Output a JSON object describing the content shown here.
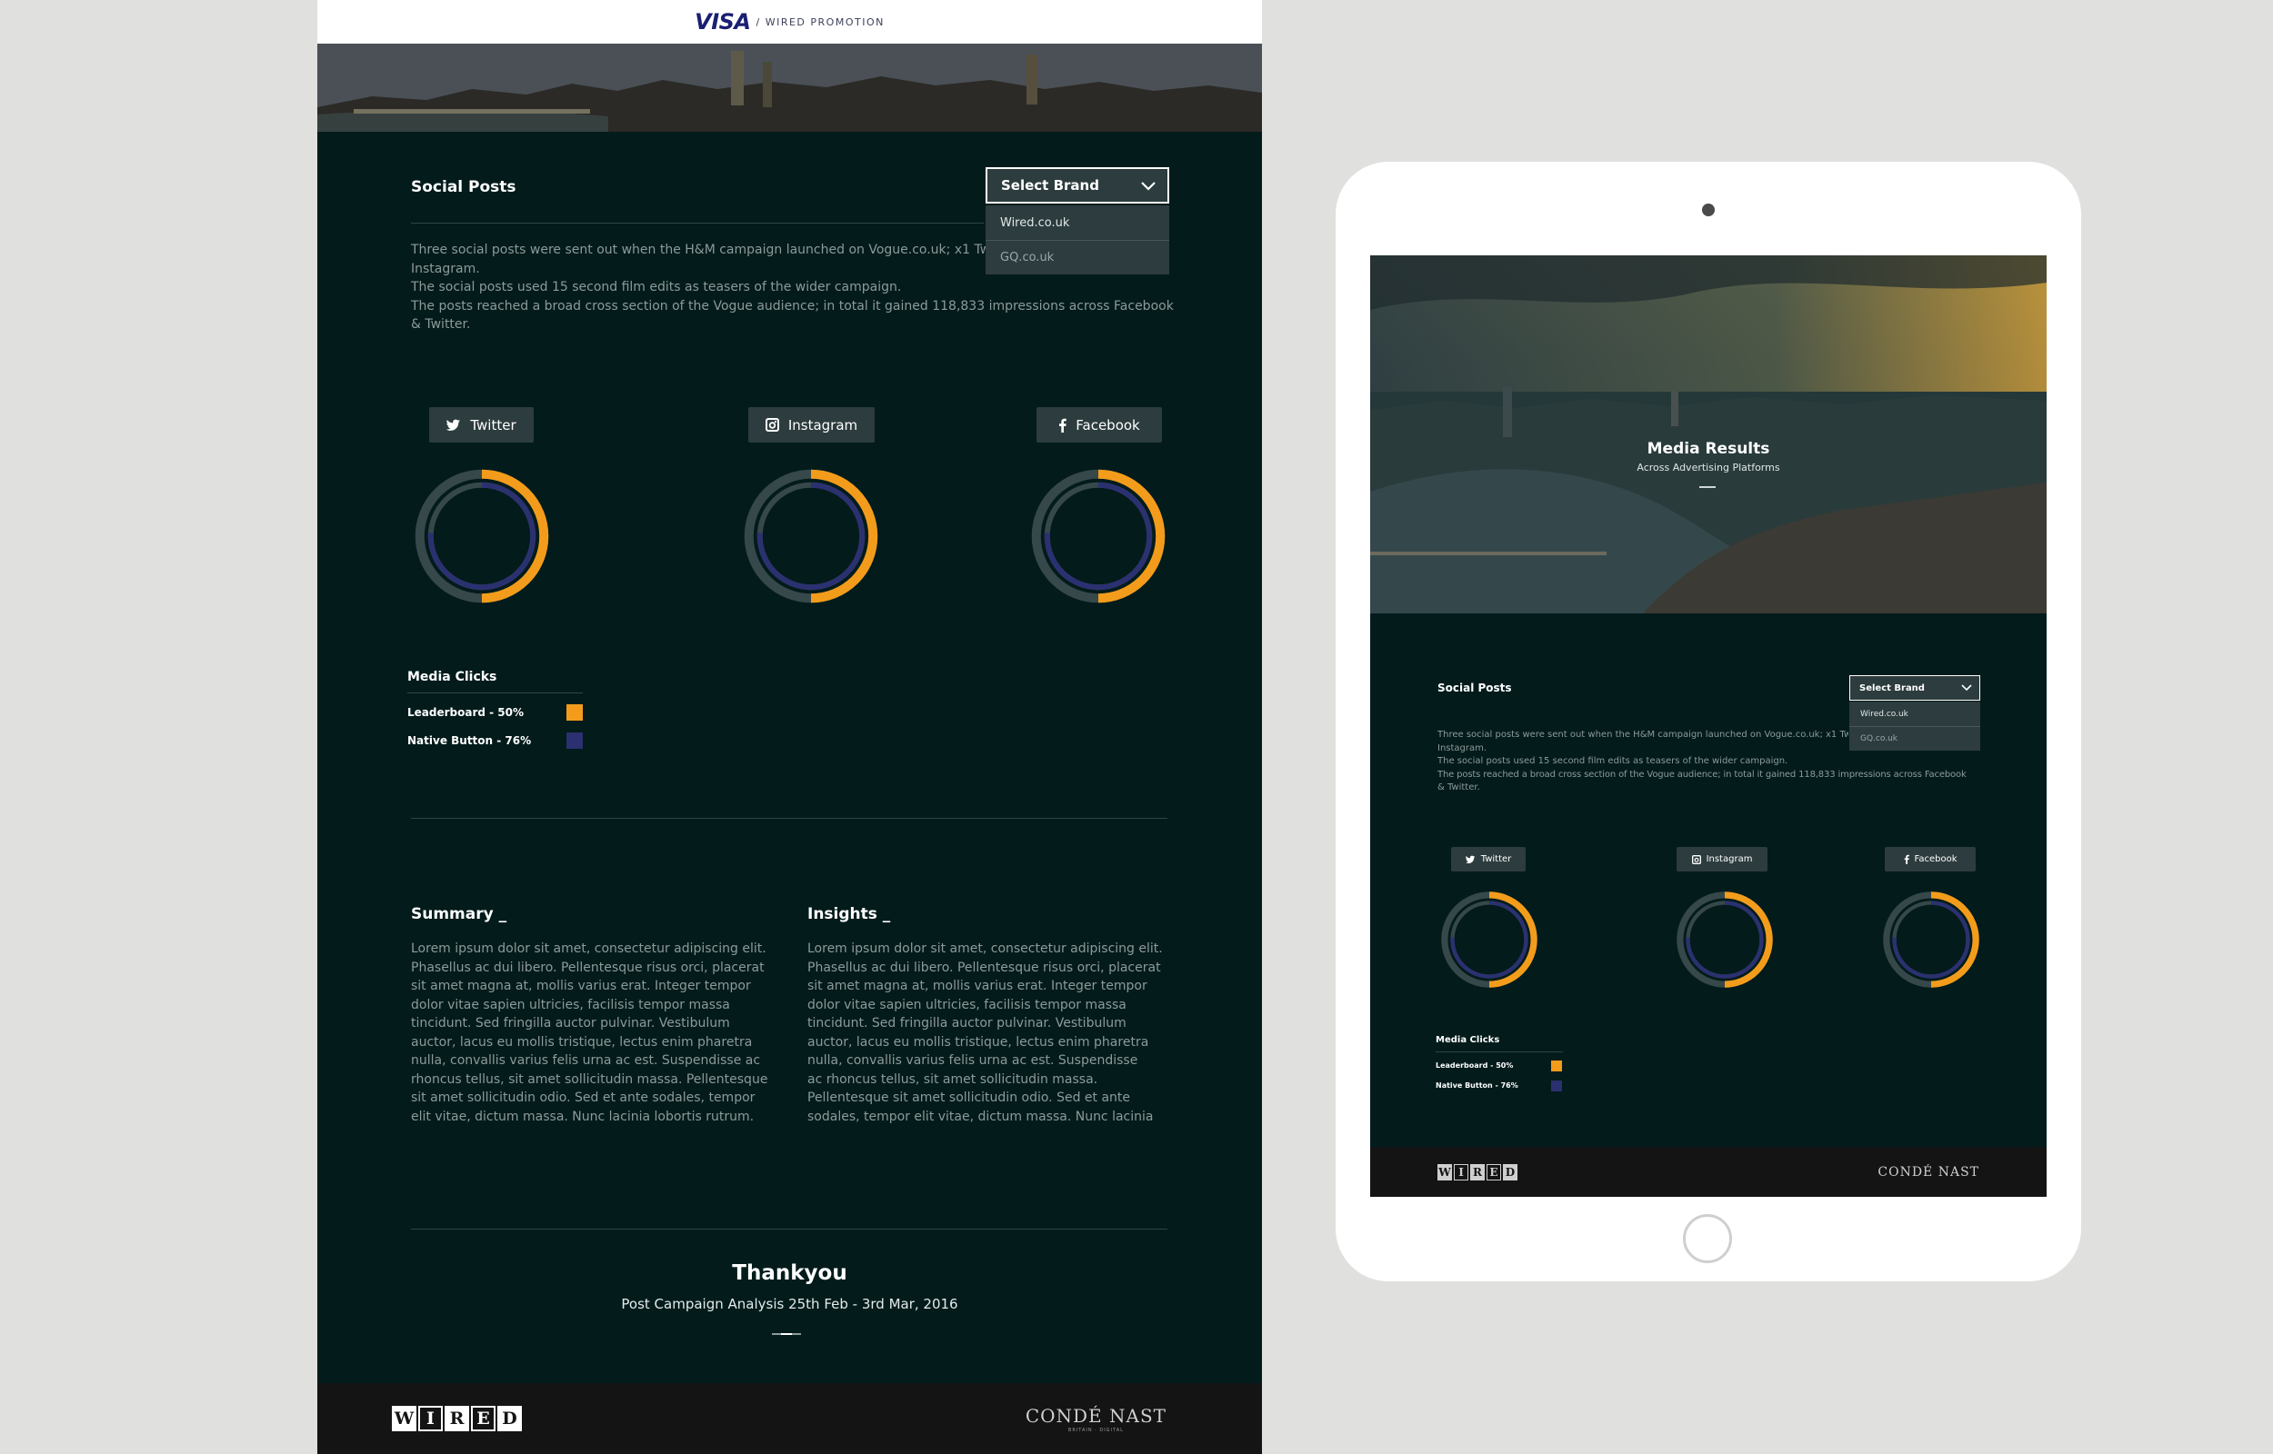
{
  "desktop": {
    "header": {
      "brand": "VISA",
      "tagline": "/ WIRED PROMOTION"
    },
    "social": {
      "title": "Social Posts",
      "select_label": "Select Brand",
      "options": [
        "Wired.co.uk",
        "GQ.co.uk"
      ],
      "paragraphs": [
        "Three social posts were sent out when the H&M campaign launched on Vogue.co.uk; x1 Twe",
        "Instagram.",
        "The social posts used 15 second film edits as teasers of the wider campaign.",
        "The posts reached a broad cross section of the Vogue audience; in total it gained 118,833 impressions across Facebook",
        "& Twitter."
      ],
      "buttons": [
        "Twitter",
        "Instagram",
        "Facebook"
      ]
    },
    "media_clicks": {
      "title": "Media Clicks",
      "items": [
        {
          "label": "Leaderboard - 50%",
          "value": 50,
          "color": "#f39c1b"
        },
        {
          "label": "Native Button - 76%",
          "value": 76,
          "color": "#2b3170"
        }
      ]
    },
    "summary": {
      "title": "Summary _",
      "lines": [
        "Lorem ipsum dolor sit amet, consectetur adipiscing elit.",
        "Phasellus ac dui libero. Pellentesque risus orci, placerat",
        "sit amet magna at, mollis varius erat. Integer tempor",
        "dolor vitae sapien ultricies, facilisis tempor massa",
        "tincidunt. Sed fringilla auctor pulvinar. Vestibulum",
        "auctor, lacus eu mollis tristique, lectus enim pharetra",
        "nulla, convallis varius felis urna ac est. Suspendisse ac",
        "rhoncus tellus, sit amet sollicitudin massa. Pellentesque",
        "sit amet sollicitudin odio. Sed et ante sodales, tempor",
        "elit vitae, dictum massa. Nunc lacinia lobortis rutrum."
      ]
    },
    "insights": {
      "title": "Insights _",
      "lines": [
        "Lorem ipsum dolor sit amet, consectetur adipiscing elit.",
        "Phasellus ac dui libero. Pellentesque risus orci, placerat",
        "sit amet magna at, mollis varius erat. Integer tempor",
        "dolor vitae sapien ultricies, facilisis tempor massa",
        "tincidunt. Sed fringilla auctor pulvinar. Vestibulum",
        "auctor, lacus eu mollis tristique, lectus enim pharetra",
        "nulla, convallis varius felis urna ac est. Suspendisse",
        "ac rhoncus tellus, sit amet sollicitudin massa.",
        "Pellentesque sit amet sollicitudin odio. Sed et ante",
        "sodales, tempor elit vitae, dictum massa. Nunc lacinia"
      ]
    },
    "thanks": {
      "title": "Thankyou",
      "subtitle": "Post Campaign Analysis 25th Feb - 3rd Mar, 2016"
    },
    "footer": {
      "wired": [
        "W",
        "I",
        "R",
        "E",
        "D"
      ],
      "conde": "CONDÉ NAST",
      "conde_small": "BRITAIN · DIGITAL"
    }
  },
  "tablet": {
    "hero": {
      "title": "Media Results",
      "subtitle": "Across Advertising Platforms"
    },
    "social": {
      "title": "Social Posts",
      "select_label": "Select Brand",
      "options": [
        "Wired.co.uk",
        "GQ.co.uk"
      ],
      "paragraphs": [
        "Three social posts were sent out when the H&M campaign launched on Vogue.co.uk; x1 Twe",
        "Instagram.",
        "The social posts used 15 second film edits as teasers of the wider campaign.",
        "The posts reached a broad cross section of the Vogue audience; in total it gained 118,833 impressions across Facebook",
        "& Twitter."
      ],
      "buttons": [
        "Twitter",
        "Instagram",
        "Facebook"
      ]
    },
    "media_clicks": {
      "title": "Media Clicks",
      "items": [
        {
          "label": "Leaderboard - 50%",
          "value": 50,
          "color": "#f39c1b"
        },
        {
          "label": "Native Button - 76%",
          "value": 76,
          "color": "#2b3170"
        }
      ]
    },
    "footer": {
      "wired": [
        "W",
        "I",
        "R",
        "E",
        "D"
      ],
      "conde": "CONDÉ NAST"
    }
  },
  "colors": {
    "background": "#031b1b",
    "panel": "#2d3c3e",
    "accent_orange": "#f39c1b",
    "accent_navy": "#2b3170",
    "ring": "#36484a"
  }
}
